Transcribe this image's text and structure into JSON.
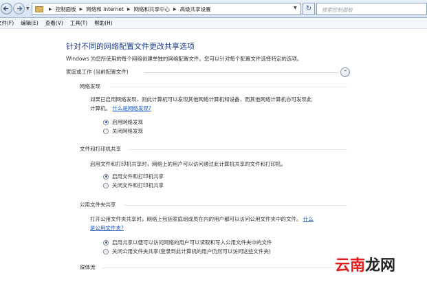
{
  "address_bar": {
    "breadcrumbs": [
      "控制面板",
      "网络和 Internet",
      "网络和共享中心",
      "高级共享设置"
    ],
    "search_placeholder": "搜索控制面板"
  },
  "menu": {
    "items": [
      "文件(F)",
      "编辑(E)",
      "查看(V)",
      "工具(T)",
      "帮助(H)"
    ]
  },
  "page": {
    "title": "针对不同的网络配置文件更改共享选项",
    "description": "Windows 为您所使用的每个网络创建单独的网络配置文件。您可以针对每个配置文件选择特定的选项。",
    "profile_heading": "家庭或工作 (当前配置文件)",
    "sections": {
      "discovery": {
        "heading": "网络发现",
        "text_line1": "如果已启用网络发现，则此计算机可以发现其他网络计算机和设备，而其他网络计算机亦可发现此",
        "text_line2": "计算机。",
        "link": "什么是网络发现?",
        "options": [
          "启用网络发现",
          "关闭网络发现"
        ],
        "selected": 0
      },
      "file_printer": {
        "heading": "文件和打印机共享",
        "text": "启用文件和打印机共享时，网络上的用户可以访问通过此计算机共享的文件和打印机。",
        "options": [
          "启用文件和打印机共享",
          "关闭文件和打印机共享"
        ],
        "selected": 0
      },
      "public_folder": {
        "heading": "公用文件夹共享",
        "text_line1": "打开公用文件夹共享时，网络上包括家庭组成员在内的用户都可以访问公用文件夹中的文件。",
        "link_part1": "什么",
        "link_part2": "是公用文件夹?",
        "options": [
          "启用共享以便可以访问网络的用户可以读取和写入公用文件夹中的文件",
          "关闭公用文件夹共享(登录到此计算机的用户仍然可以访问这些文件夹)"
        ],
        "selected": 0
      },
      "media": {
        "heading": "媒体流"
      }
    }
  },
  "watermark": {
    "part1": "云南",
    "part2": "龙网"
  }
}
